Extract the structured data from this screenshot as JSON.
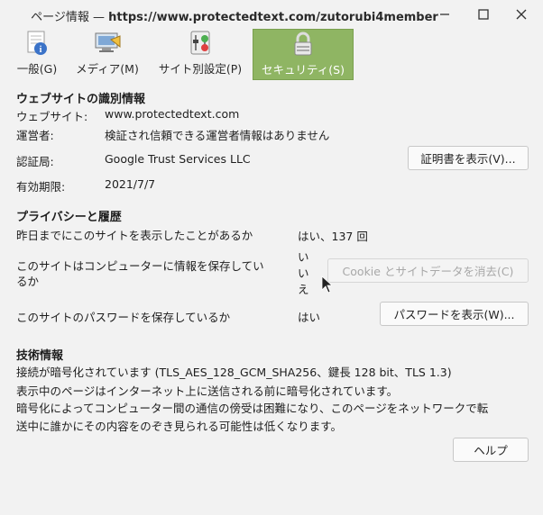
{
  "window": {
    "title_prefix": "ページ情報 — ",
    "title_url": "https://www.protectedtext.com/zutorubi4member"
  },
  "tabs": [
    {
      "label": "一般(G)",
      "icon": "page-info-icon"
    },
    {
      "label": "メディア(M)",
      "icon": "media-icon"
    },
    {
      "label": "サイト別設定(P)",
      "icon": "permissions-icon"
    },
    {
      "label": "セキュリティ(S)",
      "icon": "lock-icon"
    }
  ],
  "identity": {
    "heading": "ウェブサイトの識別情報",
    "website_label": "ウェブサイト:",
    "website_value": "www.protectedtext.com",
    "owner_label": "運営者:",
    "owner_value": "検証され信頼できる運営者情報はありません",
    "verifier_label": "認証局:",
    "verifier_value": "Google Trust Services LLC",
    "expiry_label": "有効期限:",
    "expiry_value": "2021/7/7",
    "view_cert_button": "証明書を表示(V)..."
  },
  "privacy": {
    "heading": "プライバシーと履歴",
    "visited_label": "昨日までにこのサイトを表示したことがあるか",
    "visited_value": "はい、137 回",
    "cookies_label_1": "このサイトはコンピューターに情報を保存してい",
    "cookies_label_2": "るか",
    "cookies_value_1": "い",
    "cookies_value_2": "い",
    "cookies_value_3": "え",
    "clear_cookies_button": "Cookie とサイトデータを消去(C)",
    "passwords_label": "このサイトのパスワードを保存しているか",
    "passwords_value": "はい",
    "view_passwords_button": "パスワードを表示(W)..."
  },
  "technical": {
    "heading": "技術情報",
    "line1": "接続が暗号化されています (TLS_AES_128_GCM_SHA256、鍵長 128 bit、TLS 1.3)",
    "line2": "表示中のページはインターネット上に送信される前に暗号化されています。",
    "line3a": "暗号化によってコンピューター間の通信の傍受は困難になり、このページをネットワークで転",
    "line3b": "送中に誰かにその内容をのぞき見られる可能性は低くなります。"
  },
  "help_button": "ヘルプ",
  "colors": {
    "active_tab": "#8fb563",
    "background": "#f2f2f2"
  }
}
